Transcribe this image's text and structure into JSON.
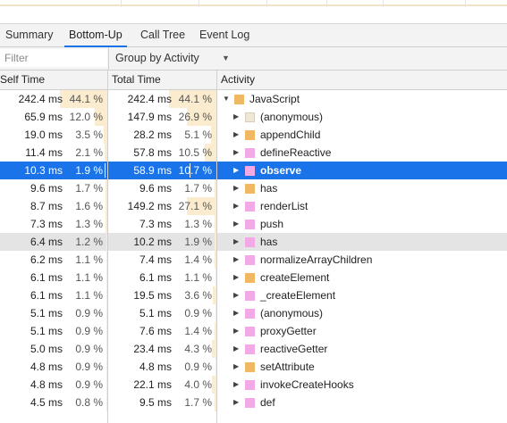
{
  "tabs": [
    {
      "label": "Summary",
      "active": false
    },
    {
      "label": "Bottom-Up",
      "active": true
    },
    {
      "label": "Call Tree",
      "active": false
    },
    {
      "label": "Event Log",
      "active": false
    }
  ],
  "toolbar": {
    "filter_placeholder": "Filter",
    "group_by": "Group by Activity",
    "group_arrow": "▼"
  },
  "columns": {
    "self_time": "Self Time",
    "total_time": "Total Time",
    "activity": "Activity"
  },
  "colors": {
    "script": "#f0b862",
    "rendering": "#f2a9e6",
    "other": "#efe6d6",
    "selection": "#1a73e8",
    "bar": "#fbeccf"
  },
  "rows": [
    {
      "self_ms": "242.4 ms",
      "self_pct": "44.1 %",
      "self_frac": 0.441,
      "total_ms": "242.4 ms",
      "total_pct": "44.1 %",
      "total_frac": 0.441,
      "name": "JavaScript",
      "expander": "▼",
      "category": "script",
      "level": 0
    },
    {
      "self_ms": "65.9 ms",
      "self_pct": "12.0 %",
      "self_frac": 0.12,
      "total_ms": "147.9 ms",
      "total_pct": "26.9 %",
      "total_frac": 0.269,
      "name": "(anonymous)",
      "expander": "▶",
      "category": "other",
      "level": 1
    },
    {
      "self_ms": "19.0 ms",
      "self_pct": "3.5 %",
      "self_frac": 0.035,
      "total_ms": "28.2 ms",
      "total_pct": "5.1 %",
      "total_frac": 0.051,
      "name": "appendChild",
      "expander": "▶",
      "category": "script",
      "level": 1
    },
    {
      "self_ms": "11.4 ms",
      "self_pct": "2.1 %",
      "self_frac": 0.021,
      "total_ms": "57.8 ms",
      "total_pct": "10.5 %",
      "total_frac": 0.105,
      "name": "defineReactive",
      "expander": "▶",
      "category": "rendering",
      "level": 1
    },
    {
      "self_ms": "10.3 ms",
      "self_pct": "1.9 %",
      "self_frac": 0.019,
      "total_ms": "58.9 ms",
      "total_pct": "10.7 %",
      "total_frac": 0.107,
      "name": "observe",
      "expander": "▶",
      "category": "rendering",
      "level": 1,
      "selected": true
    },
    {
      "self_ms": "9.6 ms",
      "self_pct": "1.7 %",
      "self_frac": 0.017,
      "total_ms": "9.6 ms",
      "total_pct": "1.7 %",
      "total_frac": 0.017,
      "name": "has",
      "expander": "▶",
      "category": "script",
      "level": 1
    },
    {
      "self_ms": "8.7 ms",
      "self_pct": "1.6 %",
      "self_frac": 0.016,
      "total_ms": "149.2 ms",
      "total_pct": "27.1 %",
      "total_frac": 0.271,
      "name": "renderList",
      "expander": "▶",
      "category": "rendering",
      "level": 1
    },
    {
      "self_ms": "7.3 ms",
      "self_pct": "1.3 %",
      "self_frac": 0.013,
      "total_ms": "7.3 ms",
      "total_pct": "1.3 %",
      "total_frac": 0.013,
      "name": "push",
      "expander": "▶",
      "category": "rendering",
      "level": 1
    },
    {
      "self_ms": "6.4 ms",
      "self_pct": "1.2 %",
      "self_frac": 0.012,
      "total_ms": "10.2 ms",
      "total_pct": "1.9 %",
      "total_frac": 0.019,
      "name": "has",
      "expander": "▶",
      "category": "rendering",
      "level": 1,
      "hovered": true
    },
    {
      "self_ms": "6.2 ms",
      "self_pct": "1.1 %",
      "self_frac": 0.011,
      "total_ms": "7.4 ms",
      "total_pct": "1.4 %",
      "total_frac": 0.014,
      "name": "normalizeArrayChildren",
      "expander": "▶",
      "category": "rendering",
      "level": 1
    },
    {
      "self_ms": "6.1 ms",
      "self_pct": "1.1 %",
      "self_frac": 0.011,
      "total_ms": "6.1 ms",
      "total_pct": "1.1 %",
      "total_frac": 0.011,
      "name": "createElement",
      "expander": "▶",
      "category": "script",
      "level": 1
    },
    {
      "self_ms": "6.1 ms",
      "self_pct": "1.1 %",
      "self_frac": 0.011,
      "total_ms": "19.5 ms",
      "total_pct": "3.6 %",
      "total_frac": 0.036,
      "name": "_createElement",
      "expander": "▶",
      "category": "rendering",
      "level": 1
    },
    {
      "self_ms": "5.1 ms",
      "self_pct": "0.9 %",
      "self_frac": 0.009,
      "total_ms": "5.1 ms",
      "total_pct": "0.9 %",
      "total_frac": 0.009,
      "name": "(anonymous)",
      "expander": "▶",
      "category": "rendering",
      "level": 1
    },
    {
      "self_ms": "5.1 ms",
      "self_pct": "0.9 %",
      "self_frac": 0.009,
      "total_ms": "7.6 ms",
      "total_pct": "1.4 %",
      "total_frac": 0.014,
      "name": "proxyGetter",
      "expander": "▶",
      "category": "rendering",
      "level": 1
    },
    {
      "self_ms": "5.0 ms",
      "self_pct": "0.9 %",
      "self_frac": 0.009,
      "total_ms": "23.4 ms",
      "total_pct": "4.3 %",
      "total_frac": 0.043,
      "name": "reactiveGetter",
      "expander": "▶",
      "category": "rendering",
      "level": 1
    },
    {
      "self_ms": "4.8 ms",
      "self_pct": "0.9 %",
      "self_frac": 0.009,
      "total_ms": "4.8 ms",
      "total_pct": "0.9 %",
      "total_frac": 0.009,
      "name": "setAttribute",
      "expander": "▶",
      "category": "script",
      "level": 1
    },
    {
      "self_ms": "4.8 ms",
      "self_pct": "0.9 %",
      "self_frac": 0.009,
      "total_ms": "22.1 ms",
      "total_pct": "4.0 %",
      "total_frac": 0.04,
      "name": "invokeCreateHooks",
      "expander": "▶",
      "category": "rendering",
      "level": 1
    },
    {
      "self_ms": "4.5 ms",
      "self_pct": "0.8 %",
      "self_frac": 0.008,
      "total_ms": "9.5 ms",
      "total_pct": "1.7 %",
      "total_frac": 0.017,
      "name": "def",
      "expander": "▶",
      "category": "rendering",
      "level": 1
    }
  ]
}
